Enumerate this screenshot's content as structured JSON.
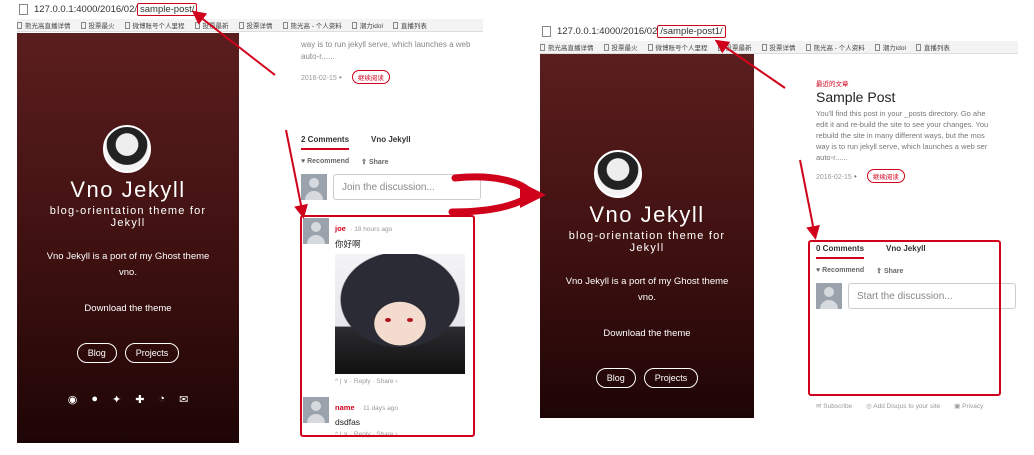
{
  "left": {
    "url_prefix": "127.0.0.1:4000/2016/02/",
    "url_highlight": "sample-post/",
    "bookmarks": [
      "熊光高直播详情",
      "投票最火",
      "微博账号个人里程",
      "投票最新",
      "投票详情",
      "熊光高 - 个人资料",
      "潮力idol",
      "直播列表"
    ],
    "excerpt": "way is to run jekyll serve, which launches a web",
    "excerpt2": "auto-r......",
    "date": "2016-02-15",
    "read_more": "继续阅读",
    "comments_tab": "2 Comments",
    "site_tab": "Vno Jekyll",
    "recommend": "Recommend",
    "share": "Share",
    "placeholder": "Join the discussion...",
    "comments": [
      {
        "author": "joe",
        "meta": "· 18 hours ago",
        "body": "你好啊",
        "foot": "^ | ∨ · Reply · Share ›"
      },
      {
        "author": "name",
        "meta": "· 11 days ago",
        "body": "dsdfas",
        "foot": "^ | ∨ · Reply · Share ›"
      }
    ]
  },
  "right": {
    "url_prefix": "127.0.0.1:4000/2016/02",
    "url_highlight": "/sample-post1/",
    "bookmarks": [
      "熊光高直播详情",
      "投票最火",
      "微博账号个人里程",
      "投票最新",
      "投票详情",
      "熊光高 - 个人资料",
      "潮力idol",
      "直播列表"
    ],
    "recent_label": "最近的文章",
    "post_title": "Sample Post",
    "post_excerpt": [
      "You'll find this post in your _posts directory. Go ahe",
      "edit it and re-build the site to see your changes. You",
      "rebuild the site in many different ways, but the mos",
      "way is to run jekyll serve, which launches a web ser",
      "auto-r......"
    ],
    "date": "2016-02-15",
    "read_more": "继续阅读",
    "comments_tab": "0 Comments",
    "site_tab": "Vno Jekyll",
    "recommend": "Recommend",
    "share": "Share",
    "placeholder": "Start the discussion...",
    "footer": [
      "Subscribe",
      "Add Disqus to your site",
      "Privacy"
    ]
  },
  "sidebar": {
    "title": "Vno Jekyll",
    "subtitle_1": "blog-orientation theme for",
    "subtitle_2": "Jekyll",
    "desc_1": "Vno Jekyll is a port of my Ghost theme",
    "desc_2": "vno.",
    "download": "Download the theme",
    "blog_btn": "Blog",
    "projects_btn": "Projects",
    "social_icons": [
      "weibo-icon",
      "github-icon",
      "twitter-icon",
      "google-plus-icon",
      "rss-icon",
      "mail-icon"
    ]
  },
  "colors": {
    "accent": "#d0021b",
    "sidebar_top": "#5b1e1e",
    "sidebar_bottom": "#1e0505"
  }
}
